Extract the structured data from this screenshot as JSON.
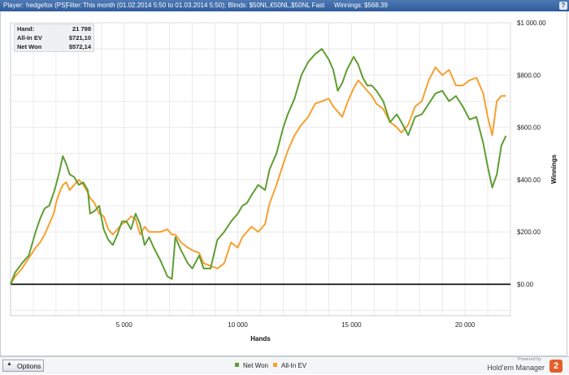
{
  "header": {
    "player_label": "Player:",
    "player_value": "hedgefox (PS)",
    "filter_label": "Filter:",
    "filter_value": "This month (01.02.2014 5:50 to 01.03.2014 5:50); Blinds: $50NL,€50NL,$50NL Fast",
    "winnings_label": "Winnings:",
    "winnings_value": "$568.39",
    "help_label": "?"
  },
  "stats": [
    {
      "label": "Hand:",
      "value": "21 798"
    },
    {
      "label": "All-In EV",
      "value": "$721,10"
    },
    {
      "label": "Net Won",
      "value": "$572,14"
    }
  ],
  "bottom": {
    "options_label": "Options",
    "powered_by": "Powered by",
    "brand_name": "Hold'em Manager",
    "brand_logo": "2"
  },
  "colors": {
    "net_won": "#5f9e34",
    "all_in_ev": "#f7a030",
    "zero_line": "#000000",
    "grid": "#e2e2e2"
  },
  "chart_data": {
    "type": "line",
    "xlabel": "Hands",
    "ylabel": "Winnings",
    "xlim": [
      0,
      22000
    ],
    "ylim": [
      -120,
      1000
    ],
    "x_ticks": [
      {
        "value": 5000,
        "label": "5 000"
      },
      {
        "value": 10000,
        "label": "10 000"
      },
      {
        "value": 15000,
        "label": "15 000"
      },
      {
        "value": 20000,
        "label": "20 000"
      }
    ],
    "y_ticks": [
      {
        "value": 0,
        "label": "$0.00"
      },
      {
        "value": 200,
        "label": "$200.00"
      },
      {
        "value": 400,
        "label": "$400.00"
      },
      {
        "value": 600,
        "label": "$600.00"
      },
      {
        "value": 800,
        "label": "$800.00"
      },
      {
        "value": 1000,
        "label": "$1 000.00"
      }
    ],
    "legend_position": "bottom",
    "series": [
      {
        "name": "Net Won",
        "color": "#5f9e34",
        "points": [
          [
            0,
            0
          ],
          [
            200,
            45
          ],
          [
            500,
            80
          ],
          [
            800,
            110
          ],
          [
            1100,
            200
          ],
          [
            1300,
            250
          ],
          [
            1500,
            290
          ],
          [
            1700,
            300
          ],
          [
            1900,
            350
          ],
          [
            2000,
            380
          ],
          [
            2150,
            430
          ],
          [
            2300,
            490
          ],
          [
            2450,
            460
          ],
          [
            2600,
            420
          ],
          [
            2800,
            410
          ],
          [
            3000,
            380
          ],
          [
            3200,
            390
          ],
          [
            3400,
            360
          ],
          [
            3500,
            270
          ],
          [
            3700,
            280
          ],
          [
            3900,
            300
          ],
          [
            4100,
            210
          ],
          [
            4300,
            170
          ],
          [
            4500,
            150
          ],
          [
            4700,
            190
          ],
          [
            4900,
            240
          ],
          [
            5100,
            240
          ],
          [
            5300,
            210
          ],
          [
            5500,
            270
          ],
          [
            5700,
            230
          ],
          [
            5900,
            150
          ],
          [
            6100,
            180
          ],
          [
            6300,
            140
          ],
          [
            6600,
            90
          ],
          [
            6900,
            30
          ],
          [
            7100,
            20
          ],
          [
            7250,
            180
          ],
          [
            7500,
            130
          ],
          [
            7800,
            80
          ],
          [
            8000,
            60
          ],
          [
            8300,
            110
          ],
          [
            8500,
            60
          ],
          [
            8800,
            60
          ],
          [
            9100,
            170
          ],
          [
            9400,
            200
          ],
          [
            9700,
            240
          ],
          [
            10000,
            270
          ],
          [
            10200,
            300
          ],
          [
            10400,
            310
          ],
          [
            10600,
            340
          ],
          [
            10900,
            380
          ],
          [
            11200,
            360
          ],
          [
            11400,
            440
          ],
          [
            11700,
            500
          ],
          [
            12000,
            600
          ],
          [
            12200,
            650
          ],
          [
            12500,
            710
          ],
          [
            12800,
            800
          ],
          [
            13100,
            850
          ],
          [
            13400,
            880
          ],
          [
            13700,
            900
          ],
          [
            14000,
            860
          ],
          [
            14200,
            820
          ],
          [
            14400,
            740
          ],
          [
            14600,
            770
          ],
          [
            14800,
            820
          ],
          [
            15100,
            870
          ],
          [
            15300,
            840
          ],
          [
            15500,
            790
          ],
          [
            15700,
            760
          ],
          [
            15900,
            760
          ],
          [
            16100,
            740
          ],
          [
            16400,
            700
          ],
          [
            16700,
            620
          ],
          [
            17000,
            650
          ],
          [
            17200,
            620
          ],
          [
            17500,
            570
          ],
          [
            17800,
            640
          ],
          [
            18100,
            650
          ],
          [
            18400,
            690
          ],
          [
            18700,
            730
          ],
          [
            19000,
            740
          ],
          [
            19300,
            700
          ],
          [
            19600,
            720
          ],
          [
            19900,
            680
          ],
          [
            20200,
            630
          ],
          [
            20500,
            640
          ],
          [
            20800,
            540
          ],
          [
            21000,
            450
          ],
          [
            21200,
            370
          ],
          [
            21400,
            420
          ],
          [
            21600,
            530
          ],
          [
            21798,
            568
          ]
        ]
      },
      {
        "name": "All-In EV",
        "color": "#f7a030",
        "points": [
          [
            0,
            0
          ],
          [
            200,
            30
          ],
          [
            500,
            60
          ],
          [
            800,
            100
          ],
          [
            1100,
            140
          ],
          [
            1300,
            160
          ],
          [
            1500,
            190
          ],
          [
            1700,
            230
          ],
          [
            1900,
            270
          ],
          [
            2000,
            310
          ],
          [
            2150,
            350
          ],
          [
            2300,
            380
          ],
          [
            2450,
            390
          ],
          [
            2600,
            360
          ],
          [
            2800,
            380
          ],
          [
            3000,
            400
          ],
          [
            3200,
            380
          ],
          [
            3400,
            350
          ],
          [
            3500,
            330
          ],
          [
            3700,
            310
          ],
          [
            3900,
            270
          ],
          [
            4100,
            260
          ],
          [
            4300,
            210
          ],
          [
            4500,
            190
          ],
          [
            4700,
            210
          ],
          [
            4900,
            230
          ],
          [
            5100,
            240
          ],
          [
            5300,
            260
          ],
          [
            5500,
            250
          ],
          [
            5700,
            190
          ],
          [
            5900,
            220
          ],
          [
            6100,
            200
          ],
          [
            6300,
            200
          ],
          [
            6600,
            200
          ],
          [
            6900,
            210
          ],
          [
            7100,
            190
          ],
          [
            7250,
            190
          ],
          [
            7500,
            160
          ],
          [
            7800,
            140
          ],
          [
            8000,
            130
          ],
          [
            8300,
            120
          ],
          [
            8500,
            80
          ],
          [
            8800,
            70
          ],
          [
            9100,
            60
          ],
          [
            9400,
            80
          ],
          [
            9700,
            160
          ],
          [
            10000,
            140
          ],
          [
            10200,
            180
          ],
          [
            10400,
            200
          ],
          [
            10600,
            220
          ],
          [
            10900,
            200
          ],
          [
            11200,
            230
          ],
          [
            11400,
            310
          ],
          [
            11700,
            380
          ],
          [
            12000,
            460
          ],
          [
            12200,
            510
          ],
          [
            12500,
            570
          ],
          [
            12800,
            610
          ],
          [
            13100,
            640
          ],
          [
            13400,
            690
          ],
          [
            13700,
            700
          ],
          [
            14000,
            710
          ],
          [
            14200,
            680
          ],
          [
            14400,
            660
          ],
          [
            14600,
            640
          ],
          [
            14800,
            690
          ],
          [
            15100,
            750
          ],
          [
            15300,
            780
          ],
          [
            15500,
            760
          ],
          [
            15700,
            740
          ],
          [
            15900,
            720
          ],
          [
            16100,
            690
          ],
          [
            16400,
            670
          ],
          [
            16700,
            620
          ],
          [
            17000,
            600
          ],
          [
            17200,
            580
          ],
          [
            17500,
            610
          ],
          [
            17800,
            680
          ],
          [
            18100,
            700
          ],
          [
            18400,
            780
          ],
          [
            18700,
            830
          ],
          [
            19000,
            800
          ],
          [
            19300,
            820
          ],
          [
            19600,
            760
          ],
          [
            19900,
            760
          ],
          [
            20200,
            780
          ],
          [
            20500,
            790
          ],
          [
            20800,
            730
          ],
          [
            21000,
            640
          ],
          [
            21200,
            570
          ],
          [
            21400,
            700
          ],
          [
            21600,
            720
          ],
          [
            21798,
            721
          ]
        ]
      }
    ]
  }
}
